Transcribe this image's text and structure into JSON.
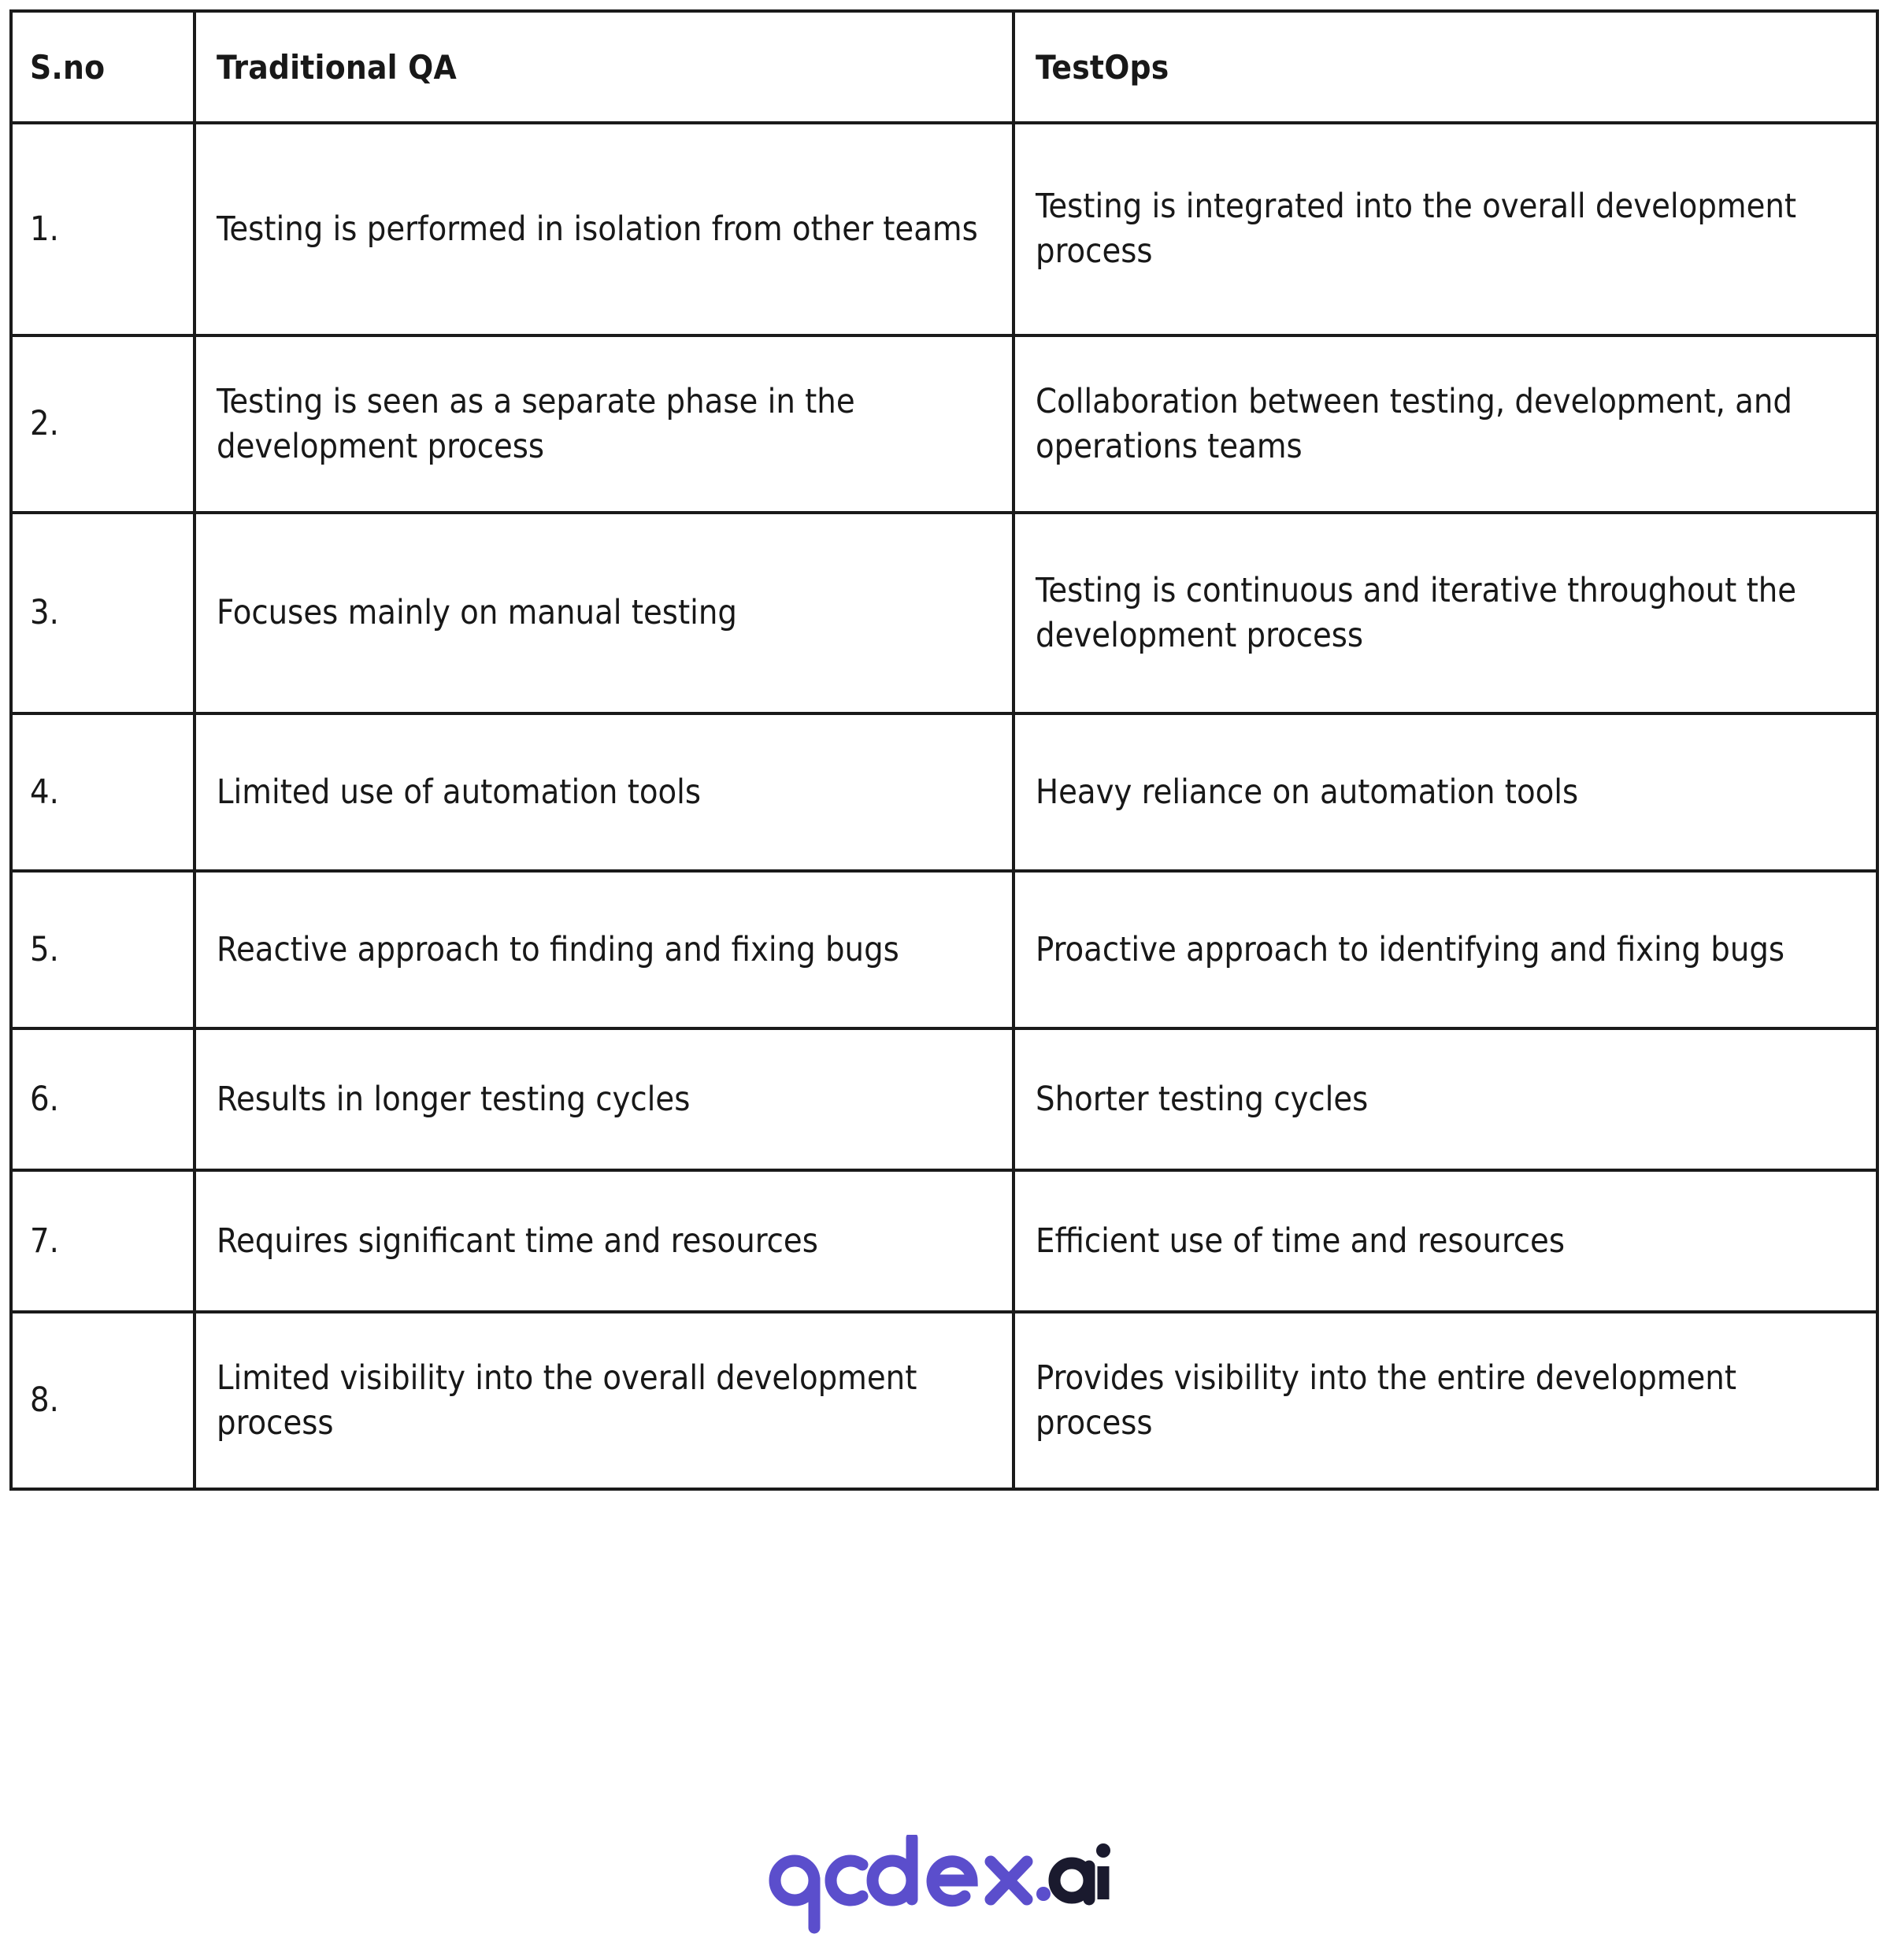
{
  "table": {
    "columns": [
      "S.no",
      "Traditional QA",
      "TestOps"
    ],
    "rows": [
      {
        "sno": "1.",
        "traditional_qa": "Testing is performed in isolation from other teams",
        "testops": "Testing is integrated into the overall development process"
      },
      {
        "sno": "2.",
        "traditional_qa": "Testing is seen as a separate phase in the development process",
        "testops": "Collaboration between testing, development, and operations teams"
      },
      {
        "sno": "3.",
        "traditional_qa": "Focuses mainly on manual testing",
        "testops": "Testing is continuous and iterative throughout the development process"
      },
      {
        "sno": "4.",
        "traditional_qa": "Limited use of automation tools",
        "testops": "Heavy reliance on automation tools"
      },
      {
        "sno": "5.",
        "traditional_qa": "Reactive approach to finding and fixing bugs",
        "testops": "Proactive approach to identifying and fixing bugs"
      },
      {
        "sno": "6.",
        "traditional_qa": "Results in longer testing cycles",
        "testops": "Shorter testing cycles"
      },
      {
        "sno": "7.",
        "traditional_qa": "Requires significant time and resources",
        "testops": "Efficient use of time and resources"
      },
      {
        "sno": "8.",
        "traditional_qa": "Limited visibility into the overall development process",
        "testops": "Provides visibility into the entire development process"
      }
    ]
  },
  "logo": {
    "brand_text": "qodex",
    "dot_text": ".",
    "suffix_text": "ai",
    "full_text": "qodex.ai",
    "brand_color": "#5B4ECC",
    "suffix_color": "#1A1A2E"
  },
  "colors": {
    "border": "#1A1A1A",
    "text": "#181818",
    "background": "#FFFFFF"
  }
}
